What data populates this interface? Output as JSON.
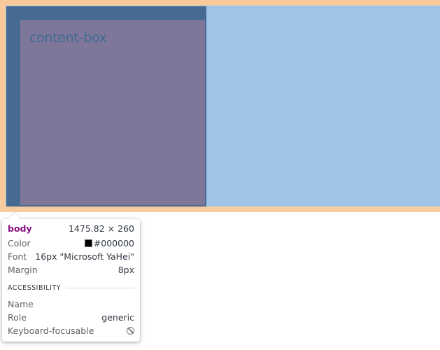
{
  "page": {
    "element_text": "content-box"
  },
  "tooltip": {
    "tag": "body",
    "dimensions": "1475.82 × 260",
    "properties": [
      {
        "label": "Color",
        "value": "#000000",
        "swatch_color": "#000000"
      },
      {
        "label": "Font",
        "value": "16px \"Microsoft YaHei\""
      },
      {
        "label": "Margin",
        "value": "8px"
      }
    ],
    "accessibility": {
      "header": "ACCESSIBILITY",
      "name_label": "Name",
      "name_value": "",
      "role_label": "Role",
      "role_value": "generic",
      "focusable_label": "Keyboard-focusable",
      "focusable_icon": "not-allowed-icon"
    }
  },
  "colors": {
    "margin_overlay": "#f9cb9c",
    "content_overlay": "#9fc4e7",
    "element_box": "#476a93",
    "element_inner": "#7f7799",
    "tag_color": "#881280"
  }
}
